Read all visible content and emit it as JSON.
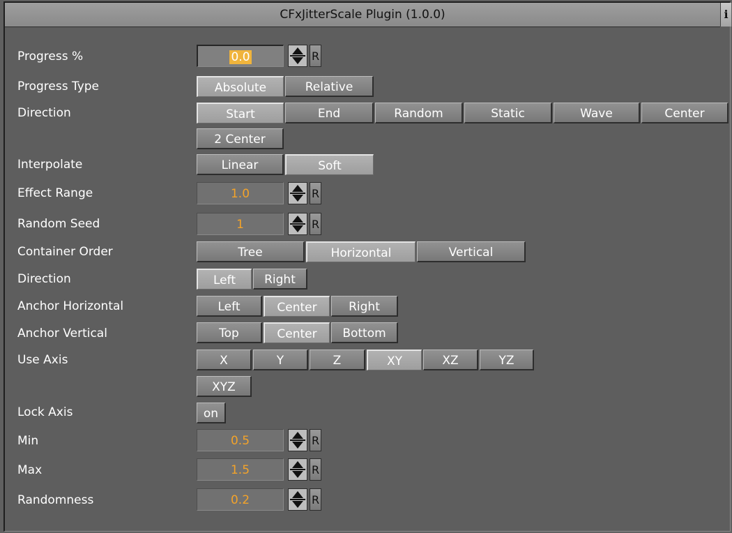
{
  "title": "CFxJitterScale Plugin (1.0.0)",
  "info_glyph": "i",
  "labels": {
    "progress": "Progress %",
    "progress_type": "Progress Type",
    "direction": "Direction",
    "interpolate": "Interpolate",
    "effect_range": "Effect Range",
    "random_seed": "Random Seed",
    "container_order": "Container Order",
    "direction2": "Direction",
    "anchor_h": "Anchor Horizontal",
    "anchor_v": "Anchor Vertical",
    "use_axis": "Use Axis",
    "lock_axis": "Lock Axis",
    "min": "Min",
    "max": "Max",
    "randomness": "Randomness"
  },
  "values": {
    "progress": "0.0",
    "effect_range": "1.0",
    "random_seed": "1",
    "min": "0.5",
    "max": "1.5",
    "randomness": "0.2"
  },
  "reset_label": "R",
  "progress_type": {
    "options": [
      "Absolute",
      "Relative"
    ],
    "selected": "Absolute"
  },
  "direction": {
    "options": [
      "Start",
      "End",
      "Random",
      "Static",
      "Wave",
      "Center",
      "2 Center"
    ],
    "selected": "Start"
  },
  "interpolate": {
    "options": [
      "Linear",
      "Soft"
    ],
    "selected": "Soft"
  },
  "container_order": {
    "options": [
      "Tree",
      "Horizontal",
      "Vertical"
    ],
    "selected": "Horizontal"
  },
  "direction2": {
    "options": [
      "Left",
      "Right"
    ],
    "selected": "Left"
  },
  "anchor_h": {
    "options": [
      "Left",
      "Center",
      "Right"
    ],
    "selected": "Center"
  },
  "anchor_v": {
    "options": [
      "Top",
      "Center",
      "Bottom"
    ],
    "selected": "Center"
  },
  "use_axis": {
    "options": [
      "X",
      "Y",
      "Z",
      "XY",
      "XZ",
      "YZ",
      "XYZ"
    ],
    "selected": "XY"
  },
  "lock_axis": {
    "label": "on",
    "selected": false
  }
}
